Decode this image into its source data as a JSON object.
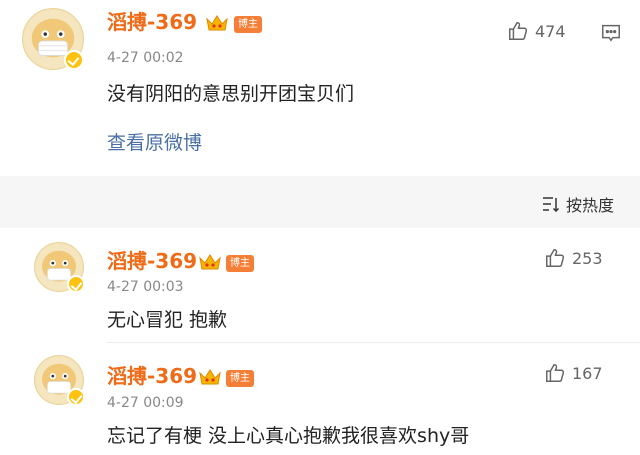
{
  "post": {
    "username": "滔搏-369",
    "badge": "博主",
    "timestamp": "4-27 00:02",
    "content": "没有阴阳的意思别开团宝贝们",
    "view_original": "查看原微博",
    "likes": "474"
  },
  "sort": {
    "label": "按热度"
  },
  "replies": [
    {
      "username": "滔搏-369",
      "badge": "博主",
      "timestamp": "4-27 00:03",
      "content": "无心冒犯 抱歉",
      "likes": "253"
    },
    {
      "username": "滔搏-369",
      "badge": "博主",
      "timestamp": "4-27 00:09",
      "content": "忘记了有梗 没上心真心抱歉我很喜欢shy哥",
      "likes": "167"
    }
  ],
  "colors": {
    "username": "#f06b17",
    "badge_bg": "#f57f37",
    "link": "#4a6fa5",
    "verified": "#ffc20e"
  },
  "icons": {
    "like": "thumbs-up-icon",
    "comment": "comment-icon",
    "sort": "sort-icon",
    "crown": "crown-icon",
    "verified": "verified-icon"
  }
}
